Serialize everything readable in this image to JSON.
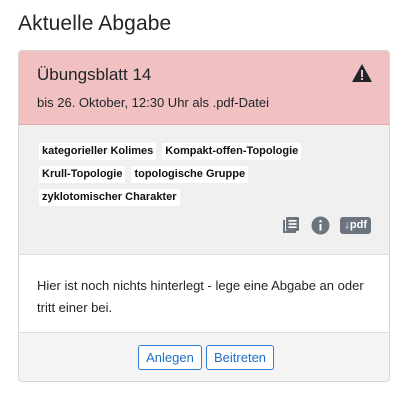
{
  "page": {
    "title": "Aktuelle Abgabe"
  },
  "assignment": {
    "title": "Übungsblatt 14",
    "due": "bis 26. Oktober, 12:30 Uhr als .pdf-Datei",
    "status_color": "#f1c1c1",
    "status_icon": "warning-icon",
    "tags_row1": [
      "kategorieller Kolimes",
      "Kompakt-offen-Topologie"
    ],
    "tags_row2": [
      "Krull-Topologie",
      "topologische Gruppe"
    ],
    "tags_row3": [
      "zyklotomischer Charakter"
    ],
    "icons": [
      "list-icon",
      "info-icon",
      "pdf-download-icon"
    ],
    "pdf_badge": "↓pdf"
  },
  "message": {
    "text": "Hier ist noch nichts hinterlegt - lege eine Abgabe an oder tritt einer bei."
  },
  "footer": {
    "create_label": "Anlegen",
    "join_label": "Beitreten",
    "accent": "#1f6fc6"
  }
}
